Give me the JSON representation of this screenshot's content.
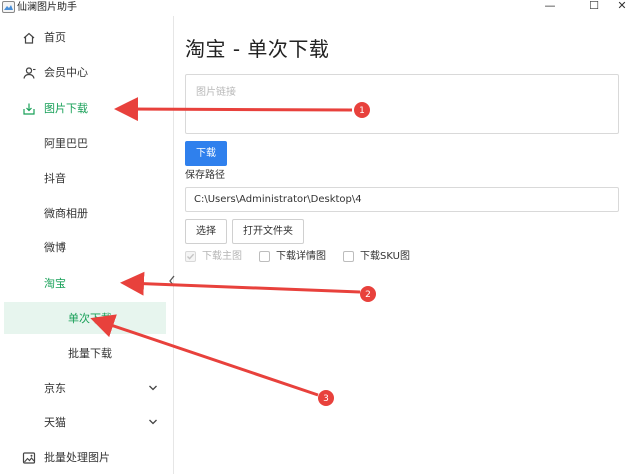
{
  "window": {
    "title": "仙澜图片助手",
    "controls": {
      "minimize": "—",
      "maximize": "☐",
      "close": "✕"
    }
  },
  "sidebar": {
    "items": [
      {
        "label": "首页",
        "icon": "home-icon"
      },
      {
        "label": "会员中心",
        "icon": "user-icon"
      },
      {
        "label": "图片下载",
        "icon": "download-icon",
        "active": true
      },
      {
        "label": "阿里巴巴"
      },
      {
        "label": "抖音"
      },
      {
        "label": "微商相册"
      },
      {
        "label": "微博"
      },
      {
        "label": "淘宝",
        "active": true
      },
      {
        "label": "单次下载",
        "selected": true
      },
      {
        "label": "批量下载"
      },
      {
        "label": "京东",
        "expandable": true
      },
      {
        "label": "天猫",
        "expandable": true
      },
      {
        "label": "批量处理图片",
        "icon": "image-icon"
      }
    ],
    "collapse_glyph": "‹"
  },
  "main": {
    "title": "淘宝 - 单次下载",
    "link_input": {
      "placeholder": "图片链接",
      "value": ""
    },
    "download_label": "下载",
    "save_path_label": "保存路径",
    "save_path_value": "C:\\Users\\Administrator\\Desktop\\4",
    "choose_label": "选择",
    "open_folder_label": "打开文件夹",
    "options": [
      {
        "label": "下载主图",
        "checked": true,
        "disabled": true
      },
      {
        "label": "下载详情图",
        "checked": false,
        "disabled": false
      },
      {
        "label": "下载SKU图",
        "checked": false,
        "disabled": false
      }
    ]
  },
  "annotations": {
    "color": "#e8413c",
    "markers": [
      "1",
      "2",
      "3"
    ]
  },
  "colors": {
    "accent": "#18a058",
    "primary_button": "#2f80ed",
    "selected_bg": "#e7f5ee"
  }
}
